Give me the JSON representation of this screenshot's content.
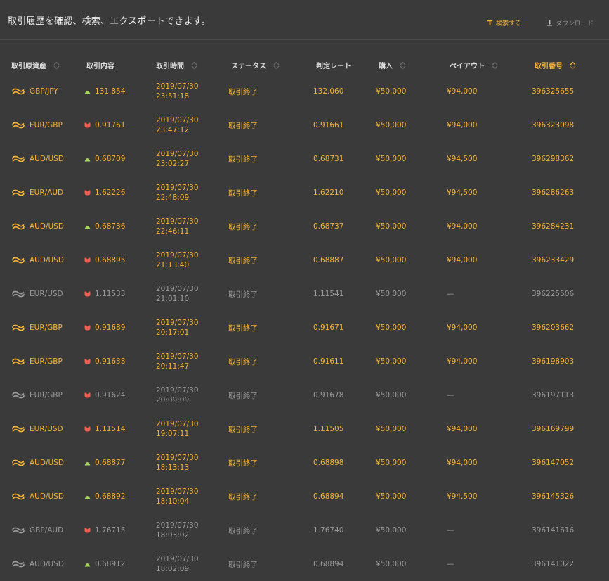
{
  "header": {
    "title": "取引履歴を確認、検索、エクスポートできます。",
    "search_label": "検索する",
    "download_label": "ダウンロード"
  },
  "colors": {
    "accent": "#f5b335",
    "up": "#a8d65a",
    "down": "#ef5b4f",
    "inactive": "#9a9a9a"
  },
  "columns": [
    {
      "key": "asset",
      "label": "取引原資産",
      "sortable": true,
      "active": false
    },
    {
      "key": "trade",
      "label": "取引内容",
      "sortable": false,
      "active": false
    },
    {
      "key": "time",
      "label": "取引時間",
      "sortable": true,
      "active": false
    },
    {
      "key": "status",
      "label": "ステータス",
      "sortable": true,
      "active": false
    },
    {
      "key": "rate",
      "label": "判定レート",
      "sortable": false,
      "active": false
    },
    {
      "key": "buy",
      "label": "購入",
      "sortable": true,
      "active": false
    },
    {
      "key": "payout",
      "label": "ペイアウト",
      "sortable": true,
      "active": false
    },
    {
      "key": "id",
      "label": "取引番号",
      "sortable": true,
      "active": true
    }
  ],
  "rows": [
    {
      "asset": "GBP/JPY",
      "dir": "up",
      "entry": "131.854",
      "date": "2019/07/30",
      "time": "23:51:18",
      "status": "取引終了",
      "rate": "132.060",
      "buy": "¥50,000",
      "payout": "¥94,000",
      "id": "396325655",
      "won": true
    },
    {
      "asset": "EUR/GBP",
      "dir": "down",
      "entry": "0.91761",
      "date": "2019/07/30",
      "time": "23:47:12",
      "status": "取引終了",
      "rate": "0.91661",
      "buy": "¥50,000",
      "payout": "¥94,000",
      "id": "396323098",
      "won": true
    },
    {
      "asset": "AUD/USD",
      "dir": "up",
      "entry": "0.68709",
      "date": "2019/07/30",
      "time": "23:02:27",
      "status": "取引終了",
      "rate": "0.68731",
      "buy": "¥50,000",
      "payout": "¥94,500",
      "id": "396298362",
      "won": true
    },
    {
      "asset": "EUR/AUD",
      "dir": "down",
      "entry": "1.62226",
      "date": "2019/07/30",
      "time": "22:48:09",
      "status": "取引終了",
      "rate": "1.62210",
      "buy": "¥50,000",
      "payout": "¥94,500",
      "id": "396286263",
      "won": true
    },
    {
      "asset": "AUD/USD",
      "dir": "up",
      "entry": "0.68736",
      "date": "2019/07/30",
      "time": "22:46:11",
      "status": "取引終了",
      "rate": "0.68737",
      "buy": "¥50,000",
      "payout": "¥94,000",
      "id": "396284231",
      "won": true
    },
    {
      "asset": "AUD/USD",
      "dir": "down",
      "entry": "0.68895",
      "date": "2019/07/30",
      "time": "21:13:40",
      "status": "取引終了",
      "rate": "0.68887",
      "buy": "¥50,000",
      "payout": "¥94,000",
      "id": "396233429",
      "won": true
    },
    {
      "asset": "EUR/USD",
      "dir": "down",
      "entry": "1.11533",
      "date": "2019/07/30",
      "time": "21:01:10",
      "status": "取引終了",
      "rate": "1.11541",
      "buy": "¥50,000",
      "payout": "—",
      "id": "396225506",
      "won": false
    },
    {
      "asset": "EUR/GBP",
      "dir": "down",
      "entry": "0.91689",
      "date": "2019/07/30",
      "time": "20:17:01",
      "status": "取引終了",
      "rate": "0.91671",
      "buy": "¥50,000",
      "payout": "¥94,000",
      "id": "396203662",
      "won": true
    },
    {
      "asset": "EUR/GBP",
      "dir": "down",
      "entry": "0.91638",
      "date": "2019/07/30",
      "time": "20:11:47",
      "status": "取引終了",
      "rate": "0.91611",
      "buy": "¥50,000",
      "payout": "¥94,000",
      "id": "396198903",
      "won": true
    },
    {
      "asset": "EUR/GBP",
      "dir": "down",
      "entry": "0.91624",
      "date": "2019/07/30",
      "time": "20:09:09",
      "status": "取引終了",
      "rate": "0.91678",
      "buy": "¥50,000",
      "payout": "—",
      "id": "396197113",
      "won": false
    },
    {
      "asset": "EUR/USD",
      "dir": "down",
      "entry": "1.11514",
      "date": "2019/07/30",
      "time": "19:07:11",
      "status": "取引終了",
      "rate": "1.11505",
      "buy": "¥50,000",
      "payout": "¥94,000",
      "id": "396169799",
      "won": true
    },
    {
      "asset": "AUD/USD",
      "dir": "up",
      "entry": "0.68877",
      "date": "2019/07/30",
      "time": "18:13:13",
      "status": "取引終了",
      "rate": "0.68898",
      "buy": "¥50,000",
      "payout": "¥94,000",
      "id": "396147052",
      "won": true
    },
    {
      "asset": "AUD/USD",
      "dir": "up",
      "entry": "0.68892",
      "date": "2019/07/30",
      "time": "18:10:04",
      "status": "取引終了",
      "rate": "0.68894",
      "buy": "¥50,000",
      "payout": "¥94,500",
      "id": "396145326",
      "won": true
    },
    {
      "asset": "GBP/AUD",
      "dir": "down",
      "entry": "1.76715",
      "date": "2019/07/30",
      "time": "18:03:02",
      "status": "取引終了",
      "rate": "1.76740",
      "buy": "¥50,000",
      "payout": "—",
      "id": "396141616",
      "won": false
    },
    {
      "asset": "AUD/USD",
      "dir": "up",
      "entry": "0.68912",
      "date": "2019/07/30",
      "time": "18:02:09",
      "status": "取引終了",
      "rate": "0.68894",
      "buy": "¥50,000",
      "payout": "—",
      "id": "396141022",
      "won": false
    }
  ]
}
